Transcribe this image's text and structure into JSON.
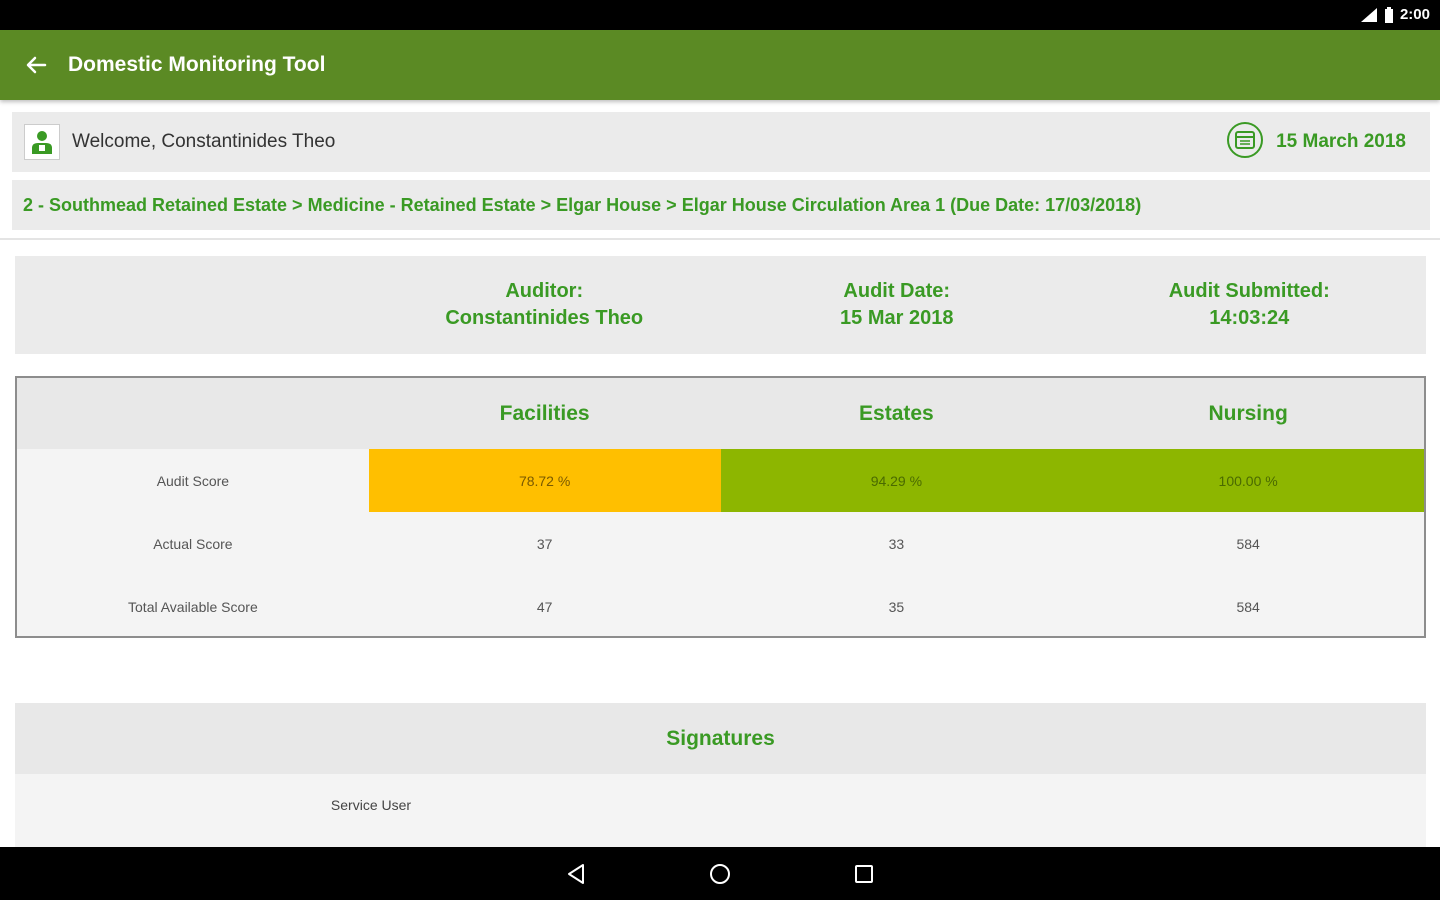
{
  "status_bar": {
    "time": "2:00"
  },
  "app_bar": {
    "title": "Domestic Monitoring Tool"
  },
  "welcome": {
    "text": "Welcome, Constantinides Theo",
    "date": "15 March 2018"
  },
  "breadcrumb": {
    "text": "2 - Southmead Retained Estate > Medicine - Retained Estate > Elgar House > Elgar House Circulation Area 1 (Due Date: 17/03/2018)"
  },
  "summary": {
    "auditor_label": "Auditor:",
    "auditor_value": "Constantinides Theo",
    "audit_date_label": "Audit Date:",
    "audit_date_value": "15 Mar 2018",
    "submitted_label": "Audit Submitted:",
    "submitted_value": "14:03:24"
  },
  "scores": {
    "headers": [
      "Facilities",
      "Estates",
      "Nursing"
    ],
    "rows": [
      {
        "label": "Audit Score",
        "values": [
          "78.72 %",
          "94.29 %",
          "100.00 %"
        ]
      },
      {
        "label": "Actual Score",
        "values": [
          "37",
          "33",
          "584"
        ]
      },
      {
        "label": "Total Available Score",
        "values": [
          "47",
          "35",
          "584"
        ]
      }
    ]
  },
  "signatures": {
    "title": "Signatures",
    "service_user_label": "Service User"
  },
  "colors": {
    "primary": "#5b8a24",
    "accent_text": "#3a9a24",
    "amber": "#ffbf00",
    "green": "#8db600"
  }
}
